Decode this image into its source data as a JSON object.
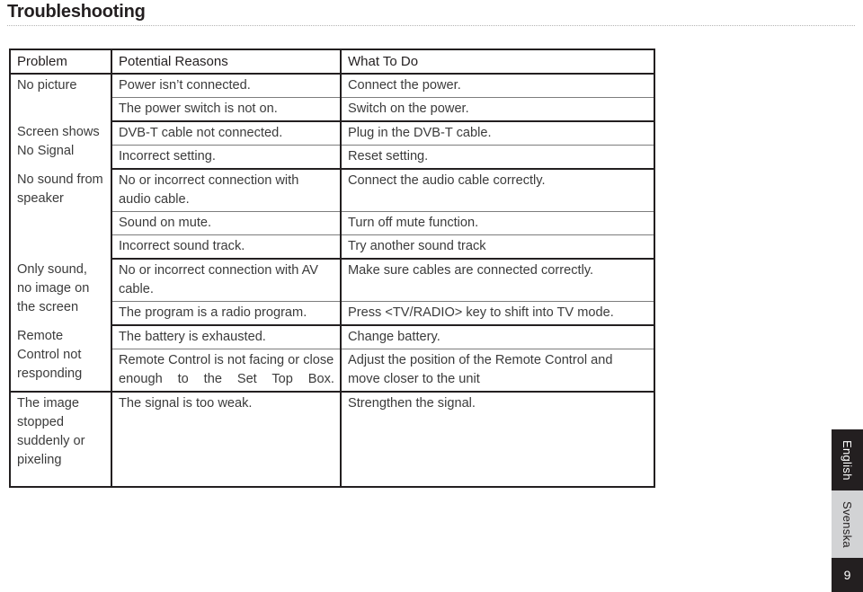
{
  "document": {
    "title": "Troubleshooting",
    "page_number": "9"
  },
  "table": {
    "headers": {
      "problem": "Problem",
      "reasons": "Potential Reasons",
      "what_to_do": "What To Do"
    },
    "groups": [
      {
        "problem": "No picture",
        "rows": [
          {
            "reason": "Power isn’t connected.",
            "action": "Connect the power."
          },
          {
            "reason": "The power switch is not on.",
            "action": "Switch on the power."
          }
        ]
      },
      {
        "problem": "Screen shows No Signal",
        "rows": [
          {
            "reason": "DVB-T cable not connected.",
            "action": "Plug in the DVB-T cable."
          },
          {
            "reason": "Incorrect setting.",
            "action": "Reset setting."
          }
        ]
      },
      {
        "problem": "No sound from speaker",
        "rows": [
          {
            "reason": "No or incorrect connection with audio cable.",
            "action": "Connect the audio cable correctly."
          },
          {
            "reason": "Sound on mute.",
            "action": "Turn off mute function."
          },
          {
            "reason": "Incorrect sound track.",
            "action": "Try another sound track"
          }
        ]
      },
      {
        "problem": "Only sound, no image on the screen",
        "rows": [
          {
            "reason": "No or incorrect connection with AV cable.",
            "action": "Make sure cables are connected correctly."
          },
          {
            "reason": "The program is a radio program.",
            "action": "Press <TV/RADIO> key to shift into TV mode."
          }
        ]
      },
      {
        "problem": "Remote Control not responding",
        "rows": [
          {
            "reason": "The battery is exhausted.",
            "action": "Change  battery."
          },
          {
            "reason": "Remote Control is not facing or close enough to the Set Top Box.",
            "action": "Adjust the position of the Remote Control and move closer to the unit"
          }
        ]
      },
      {
        "problem": "The image stopped suddenly or pixeling",
        "rows": [
          {
            "reason": "The signal is too weak.",
            "action": "Strengthen the signal."
          }
        ]
      }
    ]
  },
  "side_tabs": [
    {
      "label": "English",
      "active": true
    },
    {
      "label": "Svenska",
      "active": false
    }
  ]
}
